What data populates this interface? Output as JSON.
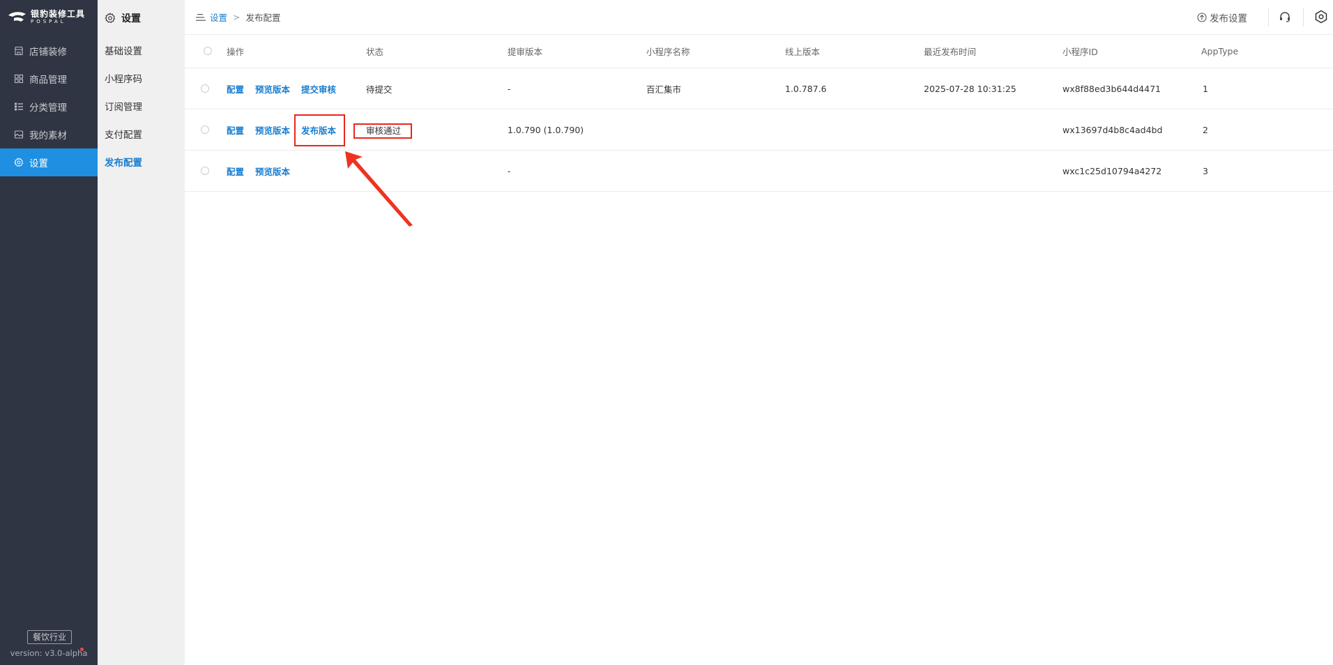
{
  "brand": {
    "name_cn": "银豹装修工具",
    "name_en": "POSPAL"
  },
  "sidebar": {
    "items": [
      {
        "label": "店铺装修",
        "icon": "store-icon"
      },
      {
        "label": "商品管理",
        "icon": "grid-icon"
      },
      {
        "label": "分类管理",
        "icon": "list-icon"
      },
      {
        "label": "我的素材",
        "icon": "image-icon"
      },
      {
        "label": "设置",
        "icon": "gear-icon",
        "active": true
      }
    ],
    "industry_badge": "餐饮行业",
    "version": "version: v3.0-alpha"
  },
  "subnav": {
    "title": "设置",
    "items": [
      {
        "label": "基础设置"
      },
      {
        "label": "小程序码"
      },
      {
        "label": "订阅管理"
      },
      {
        "label": "支付配置"
      },
      {
        "label": "发布配置",
        "active": true
      }
    ]
  },
  "topbar": {
    "breadcrumb": {
      "parent": "设置",
      "separator": ">",
      "current": "发布配置"
    },
    "publish_settings": "发布设置"
  },
  "table": {
    "columns": [
      "操作",
      "状态",
      "提审版本",
      "小程序名称",
      "线上版本",
      "最近发布时间",
      "小程序ID",
      "AppType"
    ],
    "rows": [
      {
        "actions": [
          "配置",
          "预览版本",
          "提交审核"
        ],
        "status": "待提交",
        "submit_version": "-",
        "app_name": "百汇集市",
        "online_version": "1.0.787.6",
        "last_publish": "2025-07-28 10:31:25",
        "app_id": "wx8f88ed3b644d4471",
        "app_type": "1"
      },
      {
        "actions": [
          "配置",
          "预览版本",
          "发布版本"
        ],
        "status": "审核通过",
        "submit_version": "1.0.790 (1.0.790)",
        "app_name": "",
        "online_version": "",
        "last_publish": "",
        "app_id": "wx13697d4b8c4ad4bd",
        "app_type": "2"
      },
      {
        "actions": [
          "配置",
          "预览版本"
        ],
        "status": "",
        "submit_version": "-",
        "app_name": "",
        "online_version": "",
        "last_publish": "",
        "app_id": "wxc1c25d10794a4272",
        "app_type": "3"
      }
    ]
  },
  "colors": {
    "sidebar_bg": "#2f3542",
    "accent": "#1e8fe1",
    "link": "#1a7fd0",
    "highlight": "#e8261c"
  }
}
